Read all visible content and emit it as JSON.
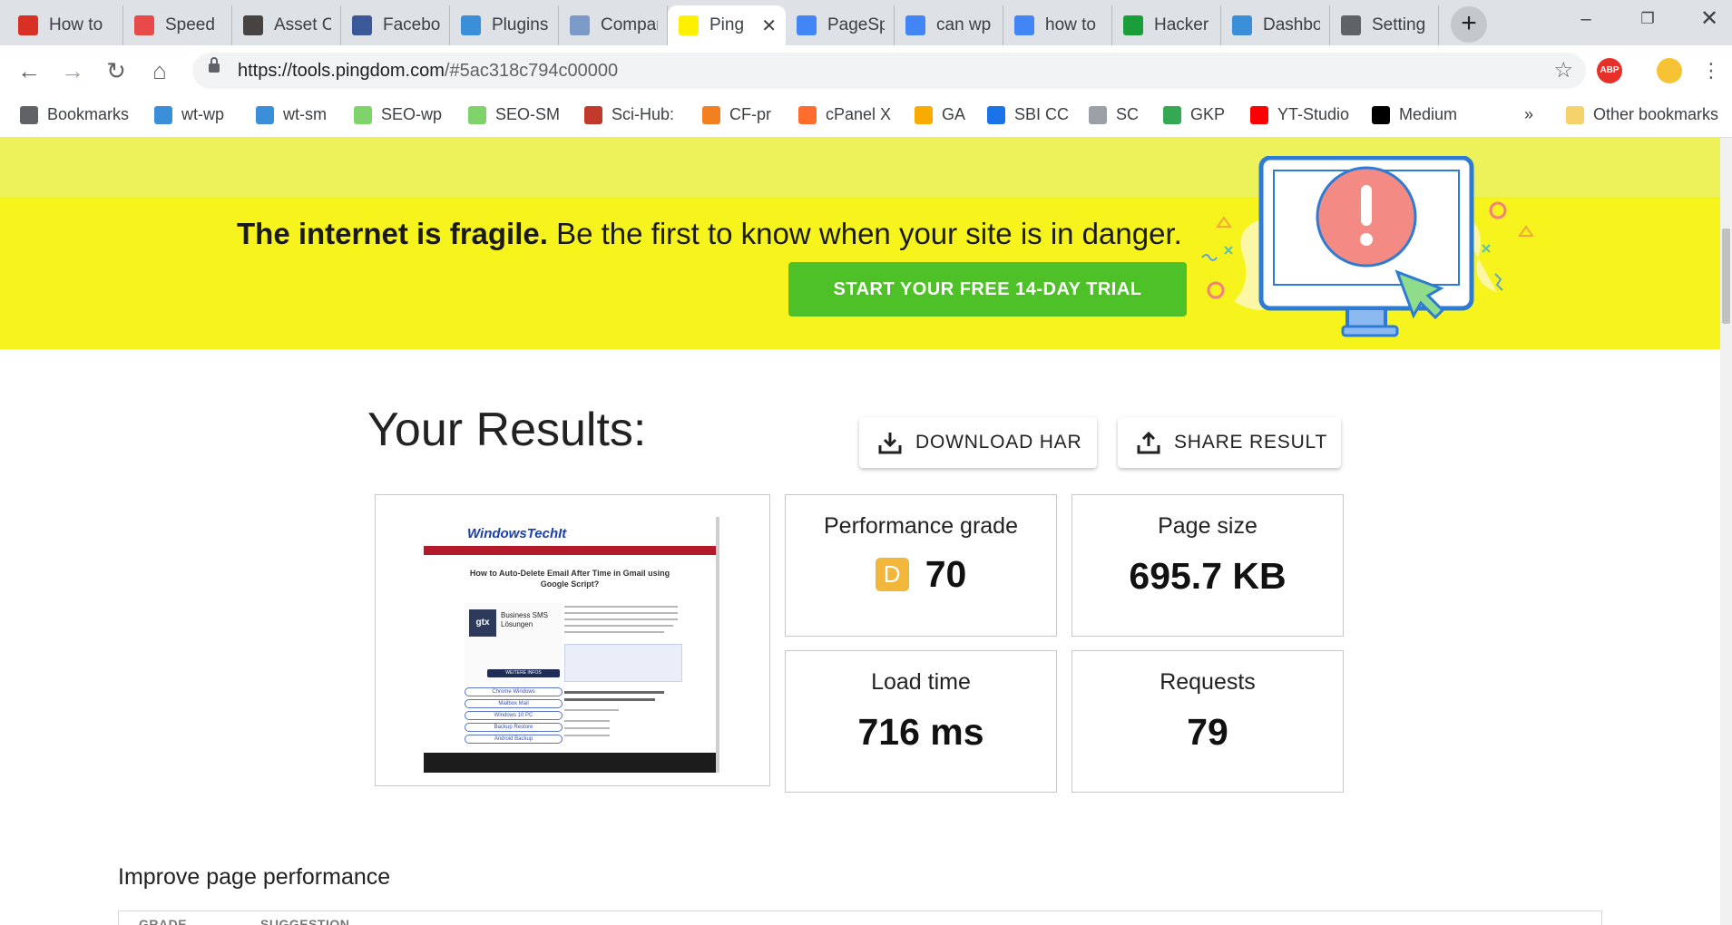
{
  "browser": {
    "tabs": [
      {
        "title": "How to",
        "icon": "gmail-icon",
        "color": "#d93025"
      },
      {
        "title": "Speed",
        "icon": "speed-icon",
        "color": "#e84a4a"
      },
      {
        "title": "Asset C",
        "icon": "wordpress-icon",
        "color": "#464342"
      },
      {
        "title": "Facebo",
        "icon": "facebook-icon",
        "color": "#3b5998"
      },
      {
        "title": "Plugins",
        "icon": "wt-icon",
        "color": "#3b8fd9"
      },
      {
        "title": "Compar",
        "icon": "gt-icon",
        "color": "#7b9ac8"
      },
      {
        "title": "Ping",
        "icon": "pingdom-icon",
        "color": "#fff000"
      },
      {
        "title": "PageSp",
        "icon": "pagespeed-icon",
        "color": "#4285f4"
      },
      {
        "title": "can wp",
        "icon": "google-icon",
        "color": "#4285f4"
      },
      {
        "title": "how to",
        "icon": "google-icon",
        "color": "#4285f4"
      },
      {
        "title": "Hacker",
        "icon": "hacker-icon",
        "color": "#1a9e3a"
      },
      {
        "title": "Dashbo",
        "icon": "wt-icon",
        "color": "#3b8fd9"
      },
      {
        "title": "Setting",
        "icon": "gear-icon",
        "color": "#5f6368"
      }
    ],
    "url_host": "https://tools.pingdom.com",
    "url_rest": "/#5ac318c794c00000",
    "bookmarks": [
      {
        "label": "Bookmarks",
        "icon": "star-icon",
        "color": "#5f6368"
      },
      {
        "label": "wt-wp",
        "icon": "wt-icon",
        "color": "#3b8fd9"
      },
      {
        "label": "wt-sm",
        "icon": "wt-icon",
        "color": "#3b8fd9"
      },
      {
        "label": "SEO-wp",
        "icon": "seo-icon",
        "color": "#7fd36a"
      },
      {
        "label": "SEO-SM",
        "icon": "seo-icon",
        "color": "#7fd36a"
      },
      {
        "label": "Sci-Hub:",
        "icon": "scihub-icon",
        "color": "#c0392b"
      },
      {
        "label": "CF-pr",
        "icon": "cloudflare-icon",
        "color": "#f38020"
      },
      {
        "label": "cPanel X",
        "icon": "cpanel-icon",
        "color": "#ff6c2c"
      },
      {
        "label": "GA",
        "icon": "analytics-icon",
        "color": "#f9ab00"
      },
      {
        "label": "SBI CC",
        "icon": "sbi-icon",
        "color": "#1a73e8"
      },
      {
        "label": "SC",
        "icon": "search-console-icon",
        "color": "#9aa0a6"
      },
      {
        "label": "GKP",
        "icon": "google-ads-icon",
        "color": "#34a853"
      },
      {
        "label": "YT-Studio",
        "icon": "youtube-icon",
        "color": "#ff0000"
      },
      {
        "label": "Medium",
        "icon": "medium-icon",
        "color": "#000000"
      }
    ],
    "more_bookmarks": "»",
    "other_bookmarks": "Other bookmarks"
  },
  "banner": {
    "bold_text": "The internet is fragile.",
    "text": " Be the first to know when your site is in danger.",
    "cta": "START YOUR FREE 14-DAY TRIAL",
    "bg_color": "#f6f41c",
    "cta_color": "#4fc128"
  },
  "results": {
    "title": "Your Results:",
    "download_label": "DOWNLOAD HAR",
    "share_label": "SHARE RESULT",
    "performance": {
      "label": "Performance grade",
      "grade": "D",
      "score": "70",
      "grade_color": "#f2b63a"
    },
    "page_size": {
      "label": "Page size",
      "value": "695.7 KB"
    },
    "load_time": {
      "label": "Load time",
      "value": "716 ms"
    },
    "requests": {
      "label": "Requests",
      "value": "79"
    }
  },
  "thumbnail": {
    "site_name": "WindowsTechIt",
    "article_title": "How to Auto-Delete Email After Time in Gmail using Google Script?",
    "ad_brand": "gtx",
    "ad_text": "Business SMS Lösungen",
    "ad_button": "WEITERE INFOS",
    "links": [
      "Chrome Windows",
      "Mailbox Mail",
      "Windows 10 PC",
      "Backup Restore",
      "Android Backup"
    ]
  },
  "improve": {
    "title": "Improve page performance",
    "col_grade": "GRADE",
    "col_suggestion": "SUGGESTION"
  }
}
